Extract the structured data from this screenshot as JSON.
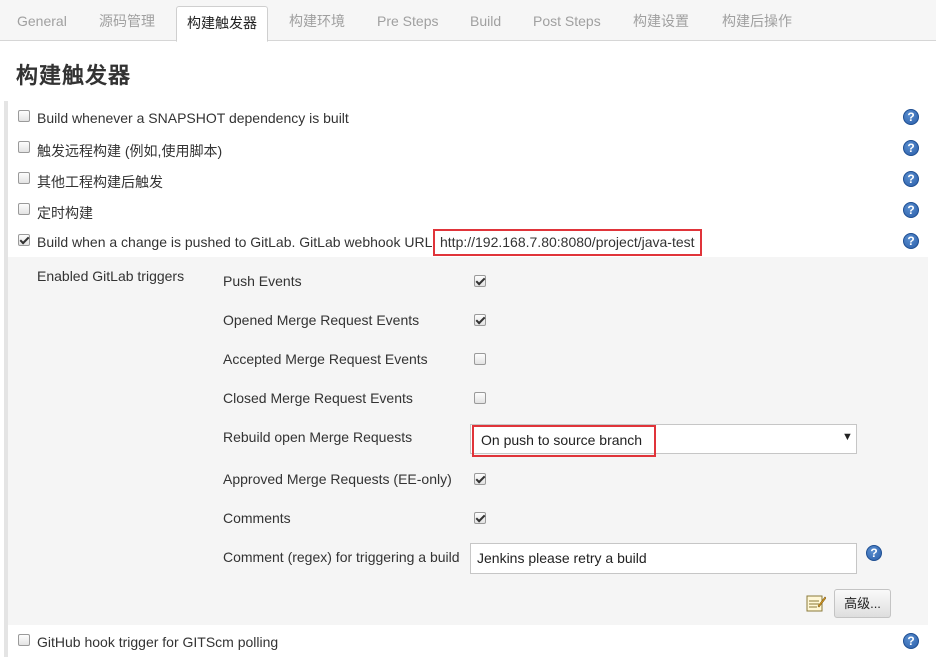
{
  "tabs": [
    {
      "label": "General"
    },
    {
      "label": "源码管理"
    },
    {
      "label": "构建触发器"
    },
    {
      "label": "构建环境"
    },
    {
      "label": "Pre Steps"
    },
    {
      "label": "Build"
    },
    {
      "label": "Post Steps"
    },
    {
      "label": "构建设置"
    },
    {
      "label": "构建后操作"
    }
  ],
  "page_title": "构建触发器",
  "triggers": [
    {
      "label": "Build whenever a SNAPSHOT dependency is built",
      "checked": false
    },
    {
      "label": "触发远程构建 (例如,使用脚本)",
      "checked": false
    },
    {
      "label": "其他工程构建后触发",
      "checked": false
    },
    {
      "label": "定时构建",
      "checked": false
    },
    {
      "label": "Build when a change is pushed to GitLab. GitLab webhook URL:",
      "checked": true
    },
    {
      "label": "GitHub hook trigger for GITScm polling",
      "checked": false
    }
  ],
  "webhook_url": "http://192.168.7.80:8080/project/java-test",
  "gitlab": {
    "section_label": "Enabled GitLab triggers",
    "options": [
      {
        "label": "Push Events",
        "checked": true
      },
      {
        "label": "Opened Merge Request Events",
        "checked": true
      },
      {
        "label": "Accepted Merge Request Events",
        "checked": false
      },
      {
        "label": "Closed Merge Request Events",
        "checked": false
      },
      {
        "label": "Rebuild open Merge Requests"
      },
      {
        "label": "Approved Merge Requests (EE-only)",
        "checked": true
      },
      {
        "label": "Comments",
        "checked": true
      },
      {
        "label": "Comment (regex) for triggering a build"
      }
    ],
    "rebuild_select": "On push to source branch",
    "comment_regex": "Jenkins please retry a build",
    "advanced_button": "高级..."
  },
  "help_glyph": "?",
  "dropdown_arrow": "▼",
  "colors": {
    "highlight_box": "#e0343a",
    "help_icon": "#2a5da8"
  }
}
